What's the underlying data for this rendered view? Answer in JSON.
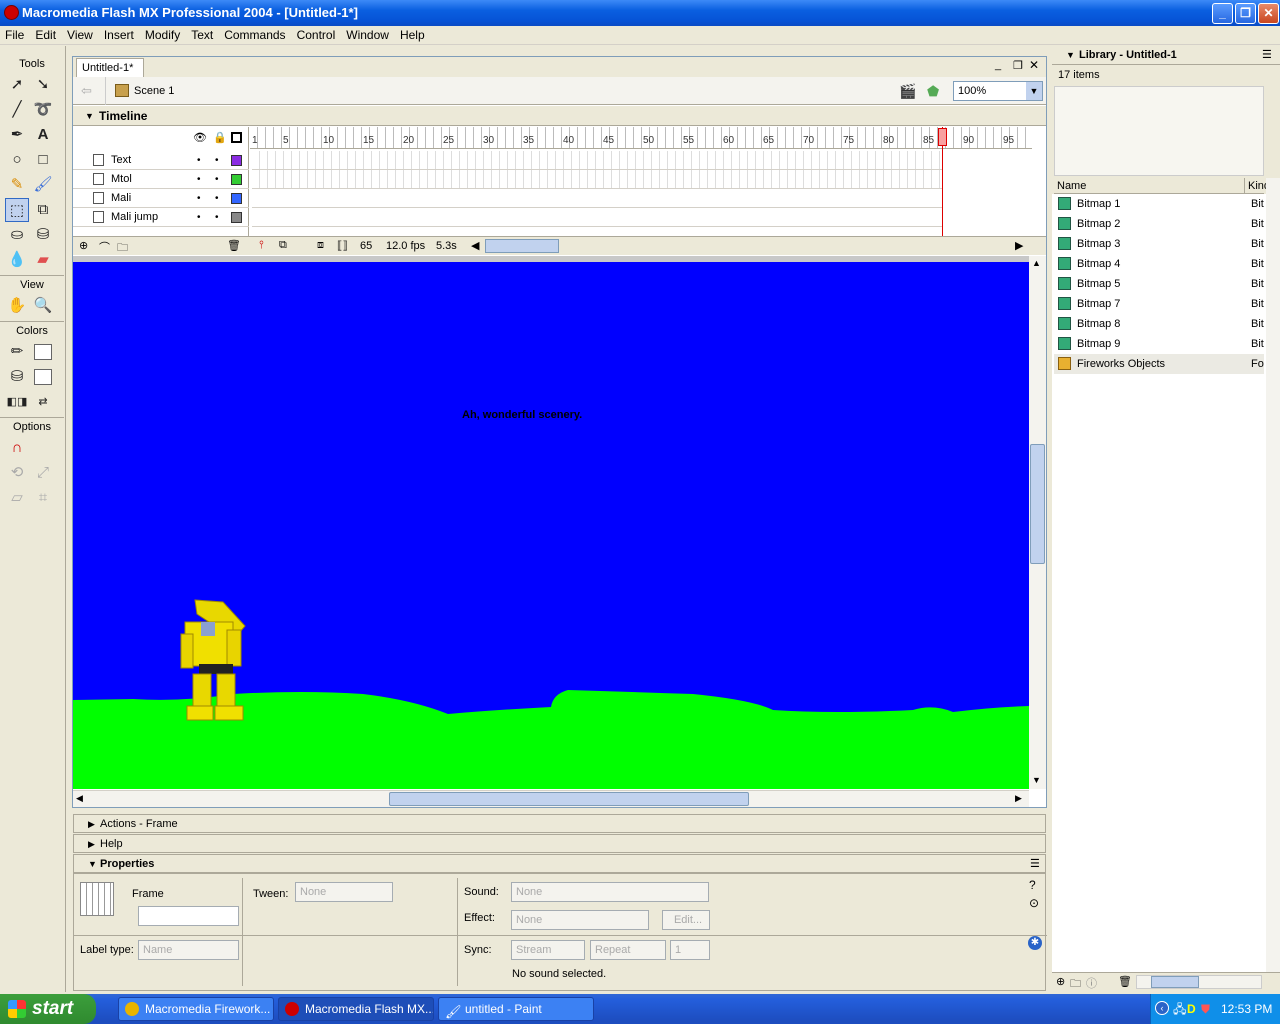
{
  "window": {
    "title": "Macromedia Flash MX Professional 2004 - [Untitled-1*]"
  },
  "menu": [
    "File",
    "Edit",
    "View",
    "Insert",
    "Modify",
    "Text",
    "Commands",
    "Control",
    "Window",
    "Help"
  ],
  "tools": {
    "label": "Tools",
    "view_label": "View",
    "colors_label": "Colors",
    "options_label": "Options"
  },
  "document": {
    "tab": "Untitled-1*",
    "scene": "Scene 1",
    "zoom": "100%"
  },
  "timeline": {
    "header": "Timeline",
    "ruler": [
      "1",
      "5",
      "10",
      "15",
      "20",
      "25",
      "30",
      "35",
      "40",
      "45",
      "50",
      "55",
      "60",
      "65",
      "70",
      "75",
      "80",
      "85",
      "90",
      "95"
    ],
    "layers": [
      {
        "name": "Text",
        "color": "#8a2be2"
      },
      {
        "name": "Mtol",
        "color": "#33cc33"
      },
      {
        "name": "Mali",
        "color": "#3366ff"
      },
      {
        "name": "Mali jump",
        "color": "#888888"
      }
    ],
    "current_frame": "65",
    "fps": "12.0 fps",
    "elapsed": "5.3s"
  },
  "stage": {
    "text": "Ah, wonderful scenery.",
    "background": "#0000ff",
    "ground": "#00ff00"
  },
  "panels": {
    "actions": "Actions - Frame",
    "help": "Help",
    "properties": "Properties"
  },
  "properties": {
    "frame_label": "Frame",
    "label_type_label": "Label type:",
    "label_type_value": "Name",
    "tween_label": "Tween:",
    "tween_value": "None",
    "sound_label": "Sound:",
    "sound_value": "None",
    "effect_label": "Effect:",
    "effect_value": "None",
    "edit_button": "Edit...",
    "sync_label": "Sync:",
    "sync_value": "Stream",
    "repeat_value": "Repeat",
    "repeat_count": "1",
    "status": "No sound selected."
  },
  "library": {
    "title": "Library - Untitled-1",
    "count": "17 items",
    "col_name": "Name",
    "col_kind": "Kind",
    "items": [
      {
        "name": "Bitmap 1",
        "kind": "Bit"
      },
      {
        "name": "Bitmap 2",
        "kind": "Bit"
      },
      {
        "name": "Bitmap 3",
        "kind": "Bit"
      },
      {
        "name": "Bitmap 4",
        "kind": "Bit"
      },
      {
        "name": "Bitmap 5",
        "kind": "Bit"
      },
      {
        "name": "Bitmap 7",
        "kind": "Bit"
      },
      {
        "name": "Bitmap 8",
        "kind": "Bit"
      },
      {
        "name": "Bitmap 9",
        "kind": "Bit"
      },
      {
        "name": "Fireworks Objects",
        "kind": "Fo"
      }
    ]
  },
  "taskbar": {
    "start": "start",
    "tasks": [
      "Macromedia Firework...",
      "Macromedia Flash MX...",
      "untitled - Paint"
    ],
    "clock": "12:53 PM"
  }
}
